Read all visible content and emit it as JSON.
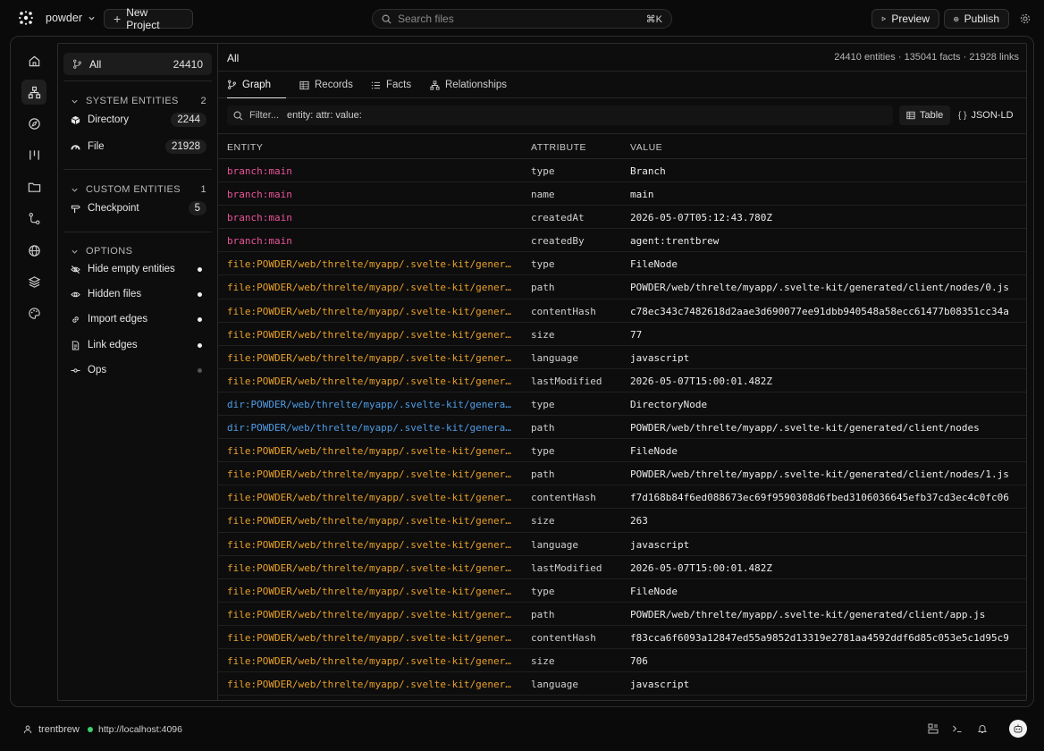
{
  "topbar": {
    "project": "powder",
    "new_project": "New Project",
    "search_placeholder": "Search files",
    "search_shortcut": "⌘K",
    "preview": "Preview",
    "publish": "Publish"
  },
  "rail": {
    "icons": [
      "home-icon",
      "graph-icon",
      "compass-icon",
      "columns-icon",
      "folder-icon",
      "git-icon",
      "globe-icon",
      "layers-icon",
      "palette-icon"
    ],
    "active_index": 1
  },
  "sidebar": {
    "all": {
      "label": "All",
      "count": "24410"
    },
    "system": {
      "title": "SYSTEM ENTITIES",
      "count": "2",
      "items": [
        {
          "label": "Directory",
          "count": "2244"
        },
        {
          "label": "File",
          "count": "21928"
        }
      ]
    },
    "custom": {
      "title": "CUSTOM ENTITIES",
      "count": "1",
      "items": [
        {
          "label": "Checkpoint",
          "count": "5"
        }
      ]
    },
    "options": {
      "title": "OPTIONS",
      "items": [
        {
          "label": "Hide empty entities",
          "enabled": true
        },
        {
          "label": "Hidden files",
          "enabled": true
        },
        {
          "label": "Import edges",
          "enabled": true
        },
        {
          "label": "Link edges",
          "enabled": true
        },
        {
          "label": "Ops",
          "enabled": false
        }
      ]
    }
  },
  "content": {
    "title": "All",
    "stats": "24410 entities · 135041 facts · 21928 links",
    "tabs": [
      "Graph",
      "Records",
      "Facts",
      "Relationships"
    ],
    "active_tab": "Graph",
    "filter_placeholder": "Filter...",
    "filter_hint": "entity: attr: value:",
    "view_table": "Table",
    "view_json": "JSON-LD",
    "columns": [
      "ENTITY",
      "ATTRIBUTE",
      "VALUE"
    ],
    "rows": [
      {
        "kind": "branch",
        "entity": "branch:main",
        "attribute": "type",
        "value": "Branch"
      },
      {
        "kind": "branch",
        "entity": "branch:main",
        "attribute": "name",
        "value": "main"
      },
      {
        "kind": "branch",
        "entity": "branch:main",
        "attribute": "createdAt",
        "value": "2026-05-07T05:12:43.780Z"
      },
      {
        "kind": "branch",
        "entity": "branch:main",
        "attribute": "createdBy",
        "value": "agent:trentbrew"
      },
      {
        "kind": "file",
        "entity": "file:POWDER/web/threlte/myapp/.svelte-kit/generated/client/nodes/0.js",
        "attribute": "type",
        "value": "FileNode"
      },
      {
        "kind": "file",
        "entity": "file:POWDER/web/threlte/myapp/.svelte-kit/generated/client/nodes/0.js",
        "attribute": "path",
        "value": "POWDER/web/threlte/myapp/.svelte-kit/generated/client/nodes/0.js"
      },
      {
        "kind": "file",
        "entity": "file:POWDER/web/threlte/myapp/.svelte-kit/generated/client/nodes/0.js",
        "attribute": "contentHash",
        "value": "c78ec343c7482618d2aae3d690077ee91dbb940548a58ecc61477b08351cc34a"
      },
      {
        "kind": "file",
        "entity": "file:POWDER/web/threlte/myapp/.svelte-kit/generated/client/nodes/0.js",
        "attribute": "size",
        "value": "77"
      },
      {
        "kind": "file",
        "entity": "file:POWDER/web/threlte/myapp/.svelte-kit/generated/client/nodes/0.js",
        "attribute": "language",
        "value": "javascript"
      },
      {
        "kind": "file",
        "entity": "file:POWDER/web/threlte/myapp/.svelte-kit/generated/client/nodes/0.js",
        "attribute": "lastModified",
        "value": "2026-05-07T15:00:01.482Z"
      },
      {
        "kind": "dir",
        "entity": "dir:POWDER/web/threlte/myapp/.svelte-kit/generated/client/nodes",
        "attribute": "type",
        "value": "DirectoryNode"
      },
      {
        "kind": "dir",
        "entity": "dir:POWDER/web/threlte/myapp/.svelte-kit/generated/client/nodes",
        "attribute": "path",
        "value": "POWDER/web/threlte/myapp/.svelte-kit/generated/client/nodes"
      },
      {
        "kind": "file",
        "entity": "file:POWDER/web/threlte/myapp/.svelte-kit/generated/client/nodes/1.js",
        "attribute": "type",
        "value": "FileNode"
      },
      {
        "kind": "file",
        "entity": "file:POWDER/web/threlte/myapp/.svelte-kit/generated/client/nodes/1.js",
        "attribute": "path",
        "value": "POWDER/web/threlte/myapp/.svelte-kit/generated/client/nodes/1.js"
      },
      {
        "kind": "file",
        "entity": "file:POWDER/web/threlte/myapp/.svelte-kit/generated/client/nodes/1.js",
        "attribute": "contentHash",
        "value": "f7d168b84f6ed088673ec69f9590308d6fbed3106036645efb37cd3ec4c0fc06"
      },
      {
        "kind": "file",
        "entity": "file:POWDER/web/threlte/myapp/.svelte-kit/generated/client/nodes/1.js",
        "attribute": "size",
        "value": "263"
      },
      {
        "kind": "file",
        "entity": "file:POWDER/web/threlte/myapp/.svelte-kit/generated/client/nodes/1.js",
        "attribute": "language",
        "value": "javascript"
      },
      {
        "kind": "file",
        "entity": "file:POWDER/web/threlte/myapp/.svelte-kit/generated/client/nodes/1.js",
        "attribute": "lastModified",
        "value": "2026-05-07T15:00:01.482Z"
      },
      {
        "kind": "file",
        "entity": "file:POWDER/web/threlte/myapp/.svelte-kit/generated/client/app.js",
        "attribute": "type",
        "value": "FileNode"
      },
      {
        "kind": "file",
        "entity": "file:POWDER/web/threlte/myapp/.svelte-kit/generated/client/app.js",
        "attribute": "path",
        "value": "POWDER/web/threlte/myapp/.svelte-kit/generated/client/app.js"
      },
      {
        "kind": "file",
        "entity": "file:POWDER/web/threlte/myapp/.svelte-kit/generated/client/app.js",
        "attribute": "contentHash",
        "value": "f83cca6f6093a12847ed55a9852d13319e2781aa4592ddf6d85c053e5c1d95c9"
      },
      {
        "kind": "file",
        "entity": "file:POWDER/web/threlte/myapp/.svelte-kit/generated/client/app.js",
        "attribute": "size",
        "value": "706"
      },
      {
        "kind": "file",
        "entity": "file:POWDER/web/threlte/myapp/.svelte-kit/generated/client/app.js",
        "attribute": "language",
        "value": "javascript"
      }
    ],
    "colors": {
      "branch": "#e9539a",
      "file": "#e8a02a",
      "dir": "#4f9de8"
    }
  },
  "status": {
    "user": "trentbrew",
    "host": "http://localhost:4096"
  }
}
